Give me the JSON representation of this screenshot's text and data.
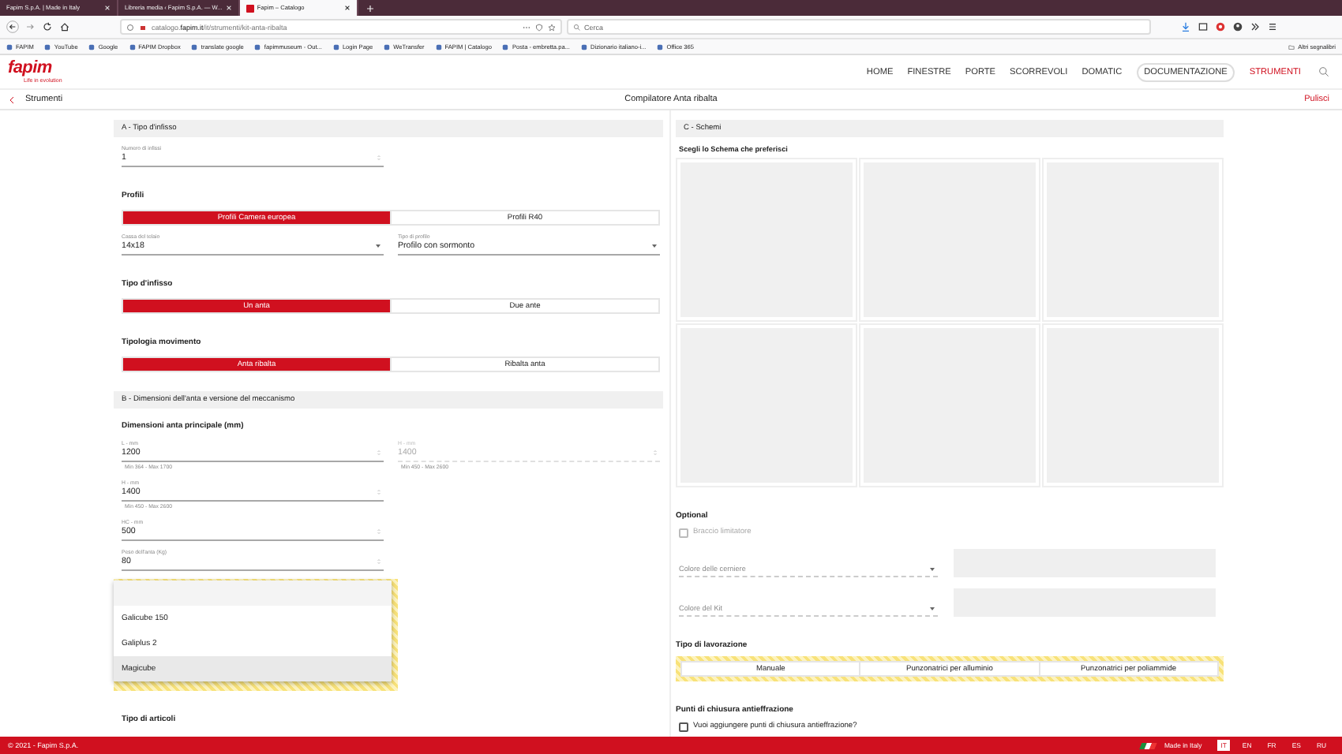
{
  "browser": {
    "tabs": [
      {
        "title": "Fapim S.p.A. | Made in Italy",
        "selected": false
      },
      {
        "title": "Libreria media ‹ Fapim S.p.A. — W...",
        "selected": false
      },
      {
        "title": "Fapim – Catalogo",
        "selected": true
      }
    ],
    "url": "catalogo.**fapim.it**/it/strumenti/kit-anta-ribalta",
    "search_placeholder": "Cerca",
    "bookmarks": [
      "FAPIM",
      "YouTube",
      "Google",
      "FAPIM Dropbox",
      "translate google",
      "fapimmuseum - Out...",
      "Login Page",
      "WeTransfer",
      "FAPIM | Catalogo",
      "Posta - embretta.pa...",
      "Dizionario italiano-i...",
      "Office 365"
    ],
    "other_bookmarks": "Altri segnalibri"
  },
  "header": {
    "logo": "fapim",
    "tagline": "Life in evolution",
    "nav": [
      {
        "label": "HOME",
        "selected": false,
        "outlined": false
      },
      {
        "label": "FINESTRE",
        "selected": false,
        "outlined": false
      },
      {
        "label": "PORTE",
        "selected": false,
        "outlined": false
      },
      {
        "label": "SCORREVOLI",
        "selected": false,
        "outlined": false
      },
      {
        "label": "DOMATIC",
        "selected": false,
        "outlined": false
      },
      {
        "label": "DOCUMENTAZIONE",
        "selected": false,
        "outlined": true
      },
      {
        "label": "STRUMENTI",
        "selected": true,
        "outlined": false
      }
    ]
  },
  "subheader": {
    "back": "Strumenti",
    "title": "Compilatore Anta ribalta",
    "action": "Pulisci"
  },
  "columns": [
    {
      "blocks": [
        {
          "kind": "section",
          "title": "A - Tipo d'infisso"
        },
        {
          "kind": "fields",
          "fields": [
            {
              "label": "Numero di infissi",
              "value": "1",
              "disabled": false
            }
          ]
        },
        {
          "kind": "heading",
          "text": "Profili"
        },
        {
          "kind": "toggle",
          "highlighted": false,
          "options": [
            {
              "label": "Profili Camera europea",
              "selected": true
            },
            {
              "label": "Profili R40",
              "selected": false
            }
          ]
        },
        {
          "kind": "selects",
          "fields": [
            {
              "label": "Cassa del telaio",
              "value": "14x18"
            },
            {
              "label": "Tipo di profilo",
              "value": "Profilo con sormonto"
            }
          ]
        },
        {
          "kind": "heading",
          "text": "Tipo d'infisso"
        },
        {
          "kind": "toggle",
          "highlighted": false,
          "options": [
            {
              "label": "Un anta",
              "selected": true
            },
            {
              "label": "Due ante",
              "selected": false
            }
          ]
        },
        {
          "kind": "heading",
          "text": "Tipologia movimento"
        },
        {
          "kind": "toggle",
          "highlighted": false,
          "options": [
            {
              "label": "Anta ribalta",
              "selected": true
            },
            {
              "label": "Ribalta anta",
              "selected": false
            }
          ]
        },
        {
          "kind": "section",
          "title": "B - Dimensioni dell'anta e versione del meccanismo"
        },
        {
          "kind": "heading",
          "text": "Dimensioni anta principale (mm)"
        },
        {
          "kind": "fields",
          "fields": [
            {
              "label": "L - mm",
              "value": "1200",
              "disabled": false,
              "hint": "Min 364 - Max 1700"
            },
            {
              "label": "H - mm",
              "value": "1400",
              "disabled": true,
              "hint": "Min 450 - Max 2600"
            }
          ]
        },
        {
          "kind": "fields",
          "fields": [
            {
              "label": "H - mm",
              "value": "1400",
              "disabled": false,
              "hint": "Min 450 - Max 2600"
            }
          ]
        },
        {
          "kind": "fields",
          "fields": [
            {
              "label": "HC - mm",
              "value": "500",
              "disabled": false
            }
          ]
        },
        {
          "kind": "fields",
          "fields": [
            {
              "label": "Peso dell'anta (Kg)",
              "value": "80",
              "disabled": false
            }
          ]
        },
        {
          "kind": "dropdown",
          "options": [
            {
              "label": "Galicube 150",
              "selected": false
            },
            {
              "label": "Galiplus 2",
              "selected": false
            },
            {
              "label": "Magicube",
              "selected": true
            }
          ]
        },
        {
          "kind": "heading",
          "text": "Tipo di articoli"
        }
      ]
    },
    {
      "blocks": [
        {
          "kind": "section",
          "title": "C - Schemi"
        },
        {
          "kind": "subheading",
          "text": "Scegli lo Schema che preferisci"
        },
        {
          "kind": "schemes",
          "cards": [
            {
              "kind": "placeholder"
            },
            {
              "kind": "placeholder"
            },
            {
              "kind": "placeholder"
            },
            {
              "kind": "placeholder"
            },
            {
              "kind": "placeholder"
            },
            {
              "kind": "placeholder"
            }
          ]
        },
        {
          "kind": "heading",
          "text": "Optional"
        },
        {
          "kind": "checkbox",
          "label": "Braccio limitatore",
          "checked": false,
          "disabled": true
        },
        {
          "kind": "color_select",
          "placeholder": "Colore delle cerniere"
        },
        {
          "kind": "color_select",
          "placeholder": "Colore del Kit"
        },
        {
          "kind": "heading",
          "text": "Tipo di lavorazione"
        },
        {
          "kind": "toggle",
          "highlighted": true,
          "options": [
            {
              "label": "Manuale",
              "selected": false
            },
            {
              "label": "Punzonatrici per alluminio",
              "selected": false
            },
            {
              "label": "Punzonatrici per poliammide",
              "selected": false
            }
          ]
        },
        {
          "kind": "heading",
          "text": "Punti di chiusura antieffrazione"
        },
        {
          "kind": "checkbox",
          "label": "Vuoi aggiungere punti di chiusura antieffrazione?",
          "checked": false,
          "disabled": false
        }
      ]
    }
  ],
  "footer": {
    "copyright": "© 2021 - Fapim S.p.A.",
    "made_in": "Made in Italy",
    "languages": [
      {
        "code": "IT",
        "selected": true
      },
      {
        "code": "EN",
        "selected": false
      },
      {
        "code": "FR",
        "selected": false
      },
      {
        "code": "ES",
        "selected": false
      },
      {
        "code": "RU",
        "selected": false
      }
    ]
  }
}
